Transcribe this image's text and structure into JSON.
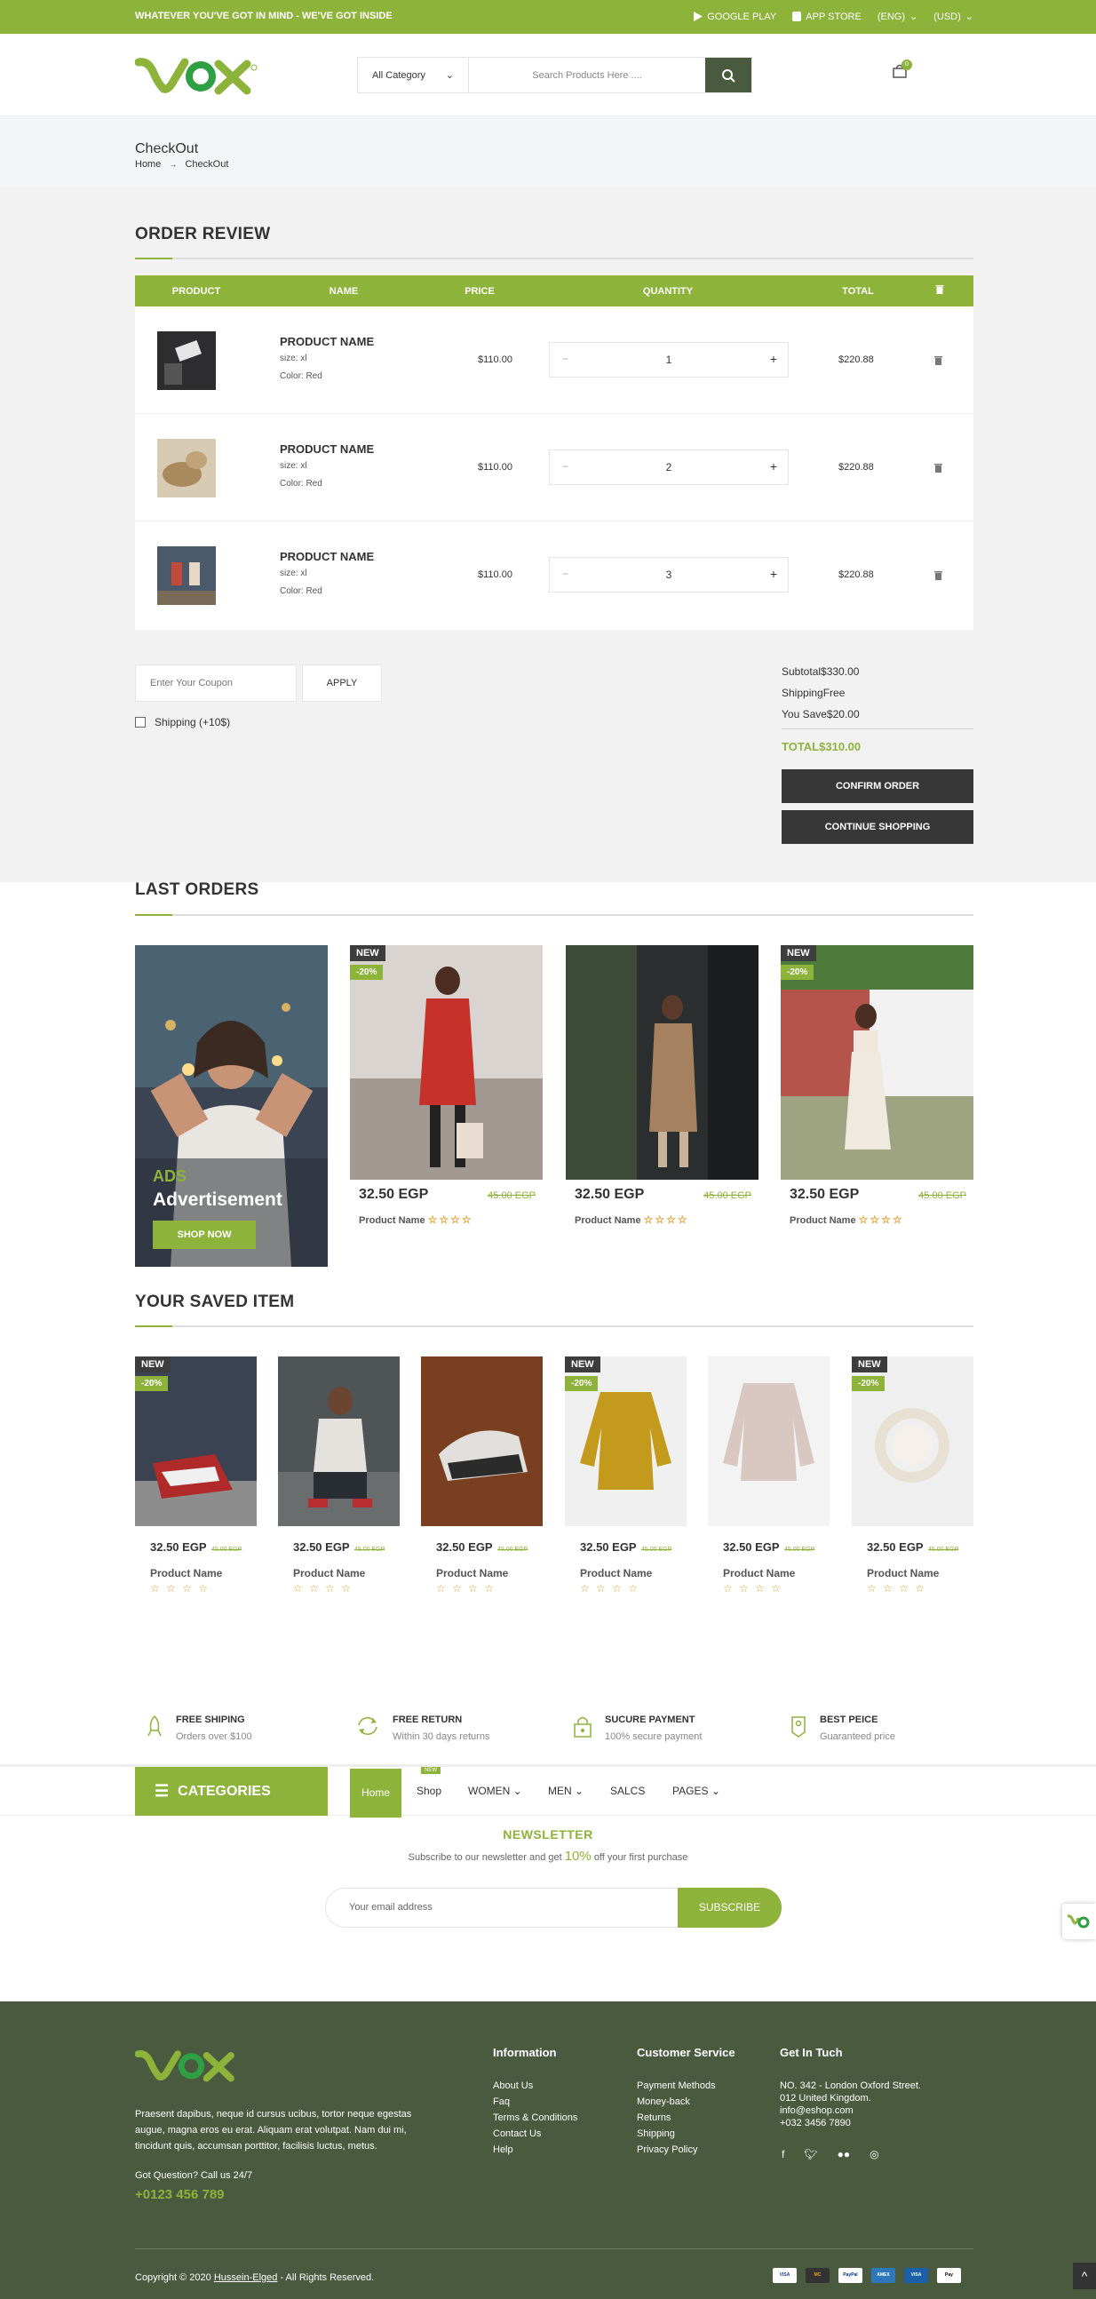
{
  "topbar": {
    "tagline": "WHATEVER YOU'VE GOT IN MIND - WE'VE GOT INSIDE",
    "google_play": "GOOGLE PLAY",
    "app_store": "APP STORE",
    "language": "(ENG)",
    "currency": "(USD)"
  },
  "header": {
    "logo_text": "VOX",
    "category_select": "All Category",
    "search_placeholder": "Search Products Here ....",
    "cart_count": "0"
  },
  "breadcrumb": {
    "title": "CheckOut",
    "home": "Home",
    "current": "CheckOut"
  },
  "order_review": {
    "title": "ORDER REVIEW",
    "columns": [
      "PRODUCT",
      "NAME",
      "PRICE",
      "QUANTITY",
      "TOTAL"
    ],
    "rows": [
      {
        "name": "PRODUCT NAME",
        "size": "size: xl",
        "color": "Color: Red",
        "price": "$110.00",
        "qty": "1",
        "total": "$220.88"
      },
      {
        "name": "PRODUCT NAME",
        "size": "size: xl",
        "color": "Color: Red",
        "price": "$110.00",
        "qty": "2",
        "total": "$220.88"
      },
      {
        "name": "PRODUCT NAME",
        "size": "size: xl",
        "color": "Color: Red",
        "price": "$110.00",
        "qty": "3",
        "total": "$220.88"
      }
    ],
    "minus": "−",
    "plus": "+"
  },
  "coupon": {
    "placeholder": "Enter Your Coupon",
    "apply": "APPLY",
    "shipping_option": "Shipping (+10$)"
  },
  "summary": {
    "subtotal": "Subtotal$330.00",
    "shipping": "ShippingFree",
    "saved": "You Save$20.00",
    "total": "TOTAL$310.00",
    "confirm": "CONFIRM ORDER",
    "continue": "CONTINUE SHOPPING"
  },
  "last_orders": {
    "title": "LAST ORDERS",
    "ad": {
      "label": "ADS",
      "title": "Advertisement",
      "button": "SHOP NOW"
    },
    "products": [
      {
        "new": "NEW",
        "off": "-20%",
        "price": "32.50 EGP",
        "old": "45.00 EGP",
        "name": "Product Name"
      },
      {
        "new": "",
        "off": "",
        "price": "32.50 EGP",
        "old": "45.00 EGP",
        "name": "Product Name"
      },
      {
        "new": "NEW",
        "off": "-20%",
        "price": "32.50 EGP",
        "old": "45.00 EGP",
        "name": "Product Name"
      }
    ],
    "stars": "☆☆☆☆"
  },
  "saved": {
    "title": "YOUR SAVED ITEM",
    "items": [
      {
        "new": "NEW",
        "off": "-20%",
        "price": "32.50 EGP",
        "old": "45.00 EGP",
        "name": "Product Name"
      },
      {
        "new": "",
        "off": "",
        "price": "32.50 EGP",
        "old": "45.00 EGP",
        "name": "Product Name"
      },
      {
        "new": "",
        "off": "",
        "price": "32.50 EGP",
        "old": "45.00 EGP",
        "name": "Product Name"
      },
      {
        "new": "NEW",
        "off": "-20%",
        "price": "32.50 EGP",
        "old": "45.00 EGP",
        "name": "Product Name"
      },
      {
        "new": "",
        "off": "",
        "price": "32.50 EGP",
        "old": "45.00 EGP",
        "name": "Product Name"
      },
      {
        "new": "NEW",
        "off": "-20%",
        "price": "32.50 EGP",
        "old": "45.00 EGP",
        "name": "Product Name"
      }
    ],
    "stars": "☆ ☆ ☆ ☆"
  },
  "features": [
    {
      "title": "FREE SHIPING",
      "sub": "Orders over $100"
    },
    {
      "title": "FREE RETURN",
      "sub": "Within 30 days returns"
    },
    {
      "title": "SUCURE PAYMENT",
      "sub": "100% secure payment"
    },
    {
      "title": "BEST PEICE",
      "sub": "Guaranteed price"
    }
  ],
  "nav": {
    "categories": "CATEGORIES",
    "home": "Home",
    "shop": "Shop",
    "shop_badge": "NEW",
    "women": "WOMEN",
    "men": "MEN",
    "sales": "SALCS",
    "pages": "PAGES"
  },
  "newsletter": {
    "title": "NEWSLETTER",
    "text_a": "Subscribe to our newsletter and get",
    "highlight": "10%",
    "text_b": "off your first purchase",
    "placeholder": "Your email address",
    "button": "SUBSCRIBE"
  },
  "footer": {
    "description": "Praesent dapibus, neque id cursus ucibus, tortor neque egestas augue, magna eros eu erat. Aliquam erat volutpat. Nam dui mi, tincidunt quis, accumsan porttitor, facilisis luctus, metus.",
    "question": "Got Question? Call us 24/7",
    "phone": "+0123 456 789",
    "information": {
      "title": "Information",
      "links": [
        "About Us",
        "Faq",
        "Terms & Conditions",
        "Contact Us",
        "Help"
      ]
    },
    "service": {
      "title": "Customer Service",
      "links": [
        "Payment Methods",
        "Money-back",
        "Returns",
        "Shipping",
        "Privacy Policy"
      ]
    },
    "contact": {
      "title": "Get In Tuch",
      "lines": [
        "NO. 342 - London Oxford Street.",
        "012 United Kingdom.",
        "info@eshop.com",
        "+032 3456 7890"
      ]
    },
    "copyright_a": "Copyright © 2020",
    "copyright_link": "Hussein-Elged",
    "copyright_b": "- All Rights Reserved.",
    "payments": [
      "VISA",
      "MC",
      "PayPal",
      "AMEX",
      "VISA",
      "Pay"
    ]
  }
}
